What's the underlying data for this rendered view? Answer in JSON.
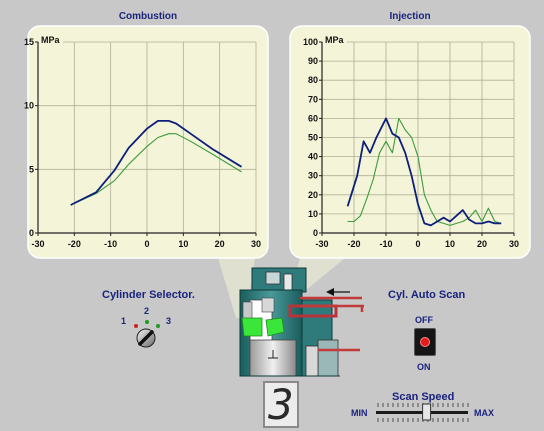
{
  "colors": {
    "background": "#c8c8c8",
    "chart_bg": "#f4f4d8",
    "primary_line": "#0d1f7a",
    "secondary_line": "#3d9a3d",
    "label_text": "#1a237e"
  },
  "combustion": {
    "title": "Combustion",
    "unit": "MPa"
  },
  "injection": {
    "title": "Injection",
    "unit": "MPa"
  },
  "chart_data": [
    {
      "type": "line",
      "title": "Combustion",
      "ylabel": "MPa",
      "xlabel": "",
      "xlim": [
        -30,
        30
      ],
      "ylim": [
        0,
        15
      ],
      "xticks": [
        -30,
        -20,
        -10,
        0,
        10,
        20,
        30
      ],
      "yticks": [
        0,
        5,
        10,
        15
      ],
      "grid": true,
      "series": [
        {
          "color": "#0d1f7a",
          "x": [
            -21,
            -14,
            -9,
            -5,
            0,
            3,
            6,
            8,
            12,
            18,
            26
          ],
          "y": [
            2.2,
            3.2,
            4.9,
            6.7,
            8.2,
            8.8,
            8.8,
            8.6,
            7.8,
            6.6,
            5.2
          ]
        },
        {
          "color": "#3d9a3d",
          "x": [
            -21,
            -14,
            -9,
            -5,
            0,
            3,
            6,
            8,
            12,
            18,
            26
          ],
          "y": [
            2.2,
            3.1,
            4.1,
            5.4,
            6.8,
            7.5,
            7.8,
            7.8,
            7.2,
            6.2,
            4.8
          ]
        }
      ]
    },
    {
      "type": "line",
      "title": "Injection",
      "ylabel": "MPa",
      "xlabel": "",
      "xlim": [
        -30,
        30
      ],
      "ylim": [
        0,
        100
      ],
      "xticks": [
        -30,
        -20,
        -10,
        0,
        10,
        20,
        30
      ],
      "yticks": [
        0,
        10,
        20,
        30,
        40,
        50,
        60,
        70,
        80,
        90,
        100
      ],
      "grid": true,
      "series": [
        {
          "color": "#0d1f7a",
          "x": [
            -22,
            -19,
            -17,
            -15,
            -13,
            -10,
            -8,
            -6,
            -4,
            -2,
            0,
            2,
            4,
            6,
            8,
            10,
            12,
            14,
            16,
            18,
            20,
            22,
            24,
            26
          ],
          "y": [
            14,
            30,
            48,
            42,
            50,
            60,
            52,
            50,
            42,
            30,
            15,
            5,
            4,
            6,
            8,
            6,
            9,
            12,
            7,
            5,
            5,
            6,
            5,
            5
          ]
        },
        {
          "color": "#3d9a3d",
          "x": [
            -22,
            -20,
            -18,
            -16,
            -14,
            -12,
            -10,
            -8,
            -6,
            -4,
            -2,
            0,
            2,
            4,
            6,
            8,
            10,
            12,
            14,
            16,
            18,
            20,
            22,
            24,
            26
          ],
          "y": [
            6,
            6,
            9,
            18,
            28,
            42,
            48,
            42,
            60,
            54,
            50,
            40,
            20,
            12,
            6,
            5,
            4,
            5,
            6,
            8,
            12,
            6,
            13,
            6,
            5
          ]
        }
      ]
    }
  ],
  "controls": {
    "cylinder_selector": {
      "label": "Cylinder Selector.",
      "positions": [
        "1",
        "2",
        "3"
      ],
      "selected": "3"
    },
    "auto_scan": {
      "label": "Cyl. Auto Scan",
      "off_label": "OFF",
      "on_label": "ON",
      "state": "OFF"
    },
    "scan_speed": {
      "label": "Scan Speed",
      "min_label": "MIN",
      "max_label": "MAX",
      "level": 0.55
    },
    "cylinder_display": "3"
  }
}
